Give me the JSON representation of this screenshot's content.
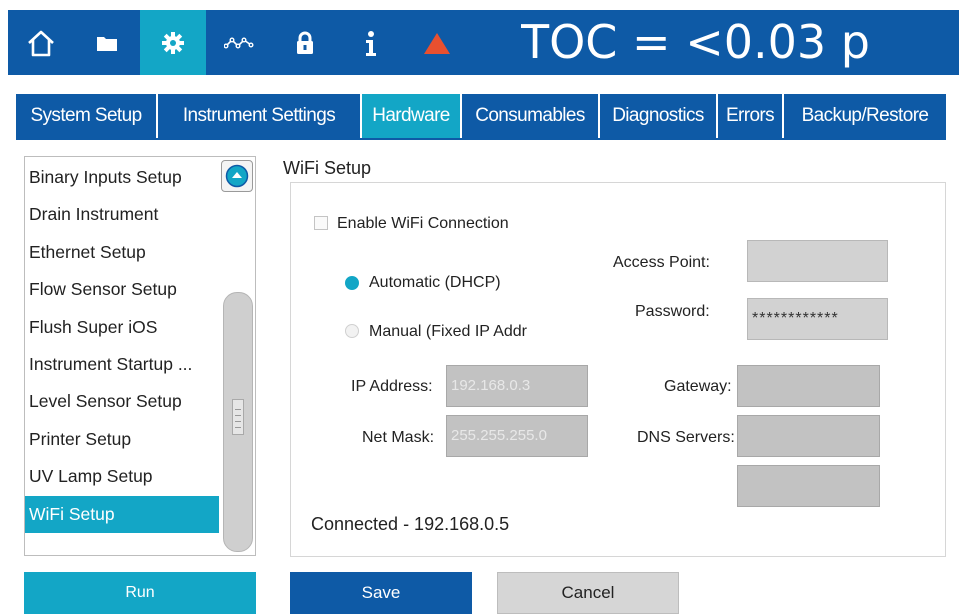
{
  "header": {
    "reading": "TOC = <0.03 p",
    "nav_icons": [
      "home-icon",
      "folder-icon",
      "gear-icon",
      "trend-icon",
      "lock-icon",
      "info-icon",
      "warning-icon"
    ],
    "accent_color": "#13a6c6",
    "brand_color": "#0e5aa6",
    "warning_color": "#e8502f"
  },
  "tabs": [
    {
      "label": "System Setup",
      "active": false
    },
    {
      "label": "Instrument Settings",
      "active": false
    },
    {
      "label": "Hardware",
      "active": true
    },
    {
      "label": "Consumables",
      "active": false
    },
    {
      "label": "Diagnostics",
      "active": false
    },
    {
      "label": "Errors",
      "active": false
    },
    {
      "label": "Backup/Restore",
      "active": false
    }
  ],
  "sidebar": {
    "items": [
      {
        "label": "Binary Inputs Setup"
      },
      {
        "label": "Drain Instrument"
      },
      {
        "label": "Ethernet Setup"
      },
      {
        "label": "Flow Sensor Setup"
      },
      {
        "label": "Flush Super iOS"
      },
      {
        "label": "Instrument Startup ..."
      },
      {
        "label": "Level Sensor Setup"
      },
      {
        "label": "Printer Setup"
      },
      {
        "label": "UV Lamp Setup"
      },
      {
        "label": "WiFi Setup"
      }
    ],
    "selected": "WiFi Setup",
    "run_label": "Run"
  },
  "wifi": {
    "group_title": "WiFi Setup",
    "enable_label": "Enable WiFi Connection",
    "enable_checked": false,
    "auto_label": "Automatic (DHCP)",
    "manual_label": "Manual (Fixed IP Addr",
    "mode": "Automatic (DHCP)",
    "access_point_label": "Access Point:",
    "access_point_value": "",
    "password_label": "Password:",
    "password_value": "************",
    "ip_label": "IP Address:",
    "ip_value": "192.168.0.3",
    "netmask_label": "Net Mask:",
    "netmask_value": "255.255.255.0",
    "gateway_label": "Gateway:",
    "gateway_value": "",
    "dns_label": "DNS Servers:",
    "dns1_value": "",
    "dns2_value": "",
    "status": "Connected - 192.168.0.5"
  },
  "footer": {
    "save_label": "Save",
    "cancel_label": "Cancel"
  }
}
